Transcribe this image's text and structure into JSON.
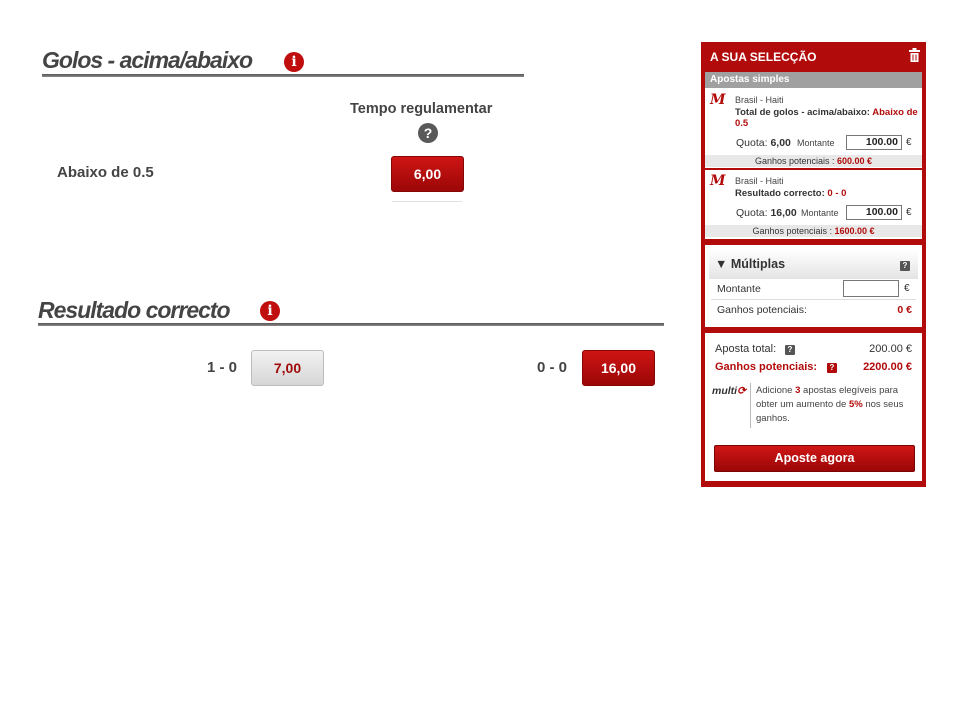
{
  "golos": {
    "title": "Golos - acima/abaixo",
    "column_header": "Tempo regulamentar",
    "row_label": "Abaixo de 0.5",
    "odds": "6,00"
  },
  "resultado": {
    "title": "Resultado correcto",
    "items": [
      {
        "label": "1 - 0",
        "odds": "7,00"
      },
      {
        "label": "0 - 0",
        "odds": "16,00"
      }
    ]
  },
  "slip": {
    "header": "A SUA SELECÇÃO",
    "singles_header": "Apostas simples",
    "bets": [
      {
        "teams": "Brasil - Haiti",
        "market": "Total de golos - acima/abaixo:",
        "selection": "Abaixo de 0.5",
        "quota_label": "Quota:",
        "quota": "6,00",
        "montante_label": "Montante",
        "stake": "100.00",
        "currency": "€",
        "potential_label": "Ganhos potenciais :",
        "potential": "600.00 €"
      },
      {
        "teams": "Brasil - Haiti",
        "market": "Resultado correcto:",
        "selection": "0 - 0",
        "quota_label": "Quota:",
        "quota": "16,00",
        "montante_label": "Montante",
        "stake": "100.00",
        "currency": "€",
        "potential_label": "Ganhos potenciais :",
        "potential": "1600.00 €"
      }
    ],
    "multiples": {
      "title": "Múltiplas",
      "montante_label": "Montante",
      "currency": "€",
      "potential_label": "Ganhos potenciais:",
      "potential": "0 €"
    },
    "summary": {
      "total_label": "Aposta total:",
      "total": "200.00 €",
      "potential_label": "Ganhos potenciais:",
      "potential": "2200.00 €",
      "promo_logo": "multi",
      "promo_pre": "Adicione ",
      "promo_count": "3",
      "promo_mid": " apostas elegíveis para obter um aumento de ",
      "promo_pct": "5%",
      "promo_post": " nos seus ganhos."
    },
    "cta": "Aposte agora"
  },
  "colors": {
    "brand_red": "#b20b0b",
    "odds_selected": "#c00d0d"
  }
}
